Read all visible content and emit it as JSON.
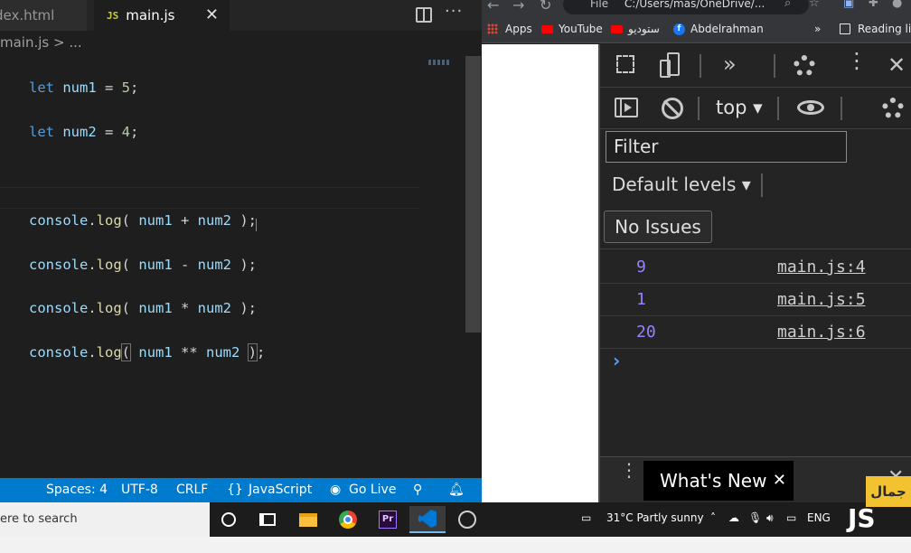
{
  "editor": {
    "tabs": [
      {
        "label": "dex.html"
      },
      {
        "label": "main.js",
        "badge": "JS"
      }
    ],
    "breadcrumb": "main.js > ...",
    "code_lines": [
      "let num1 = 5;",
      "let num2 = 4;",
      "",
      "console.log( num1 + num2 );",
      "console.log( num1 - num2 );",
      "console.log( num1 * num2 );",
      "console.log( num1 ** num2 );"
    ],
    "status": {
      "spaces": "Spaces: 4",
      "encoding": "UTF-8",
      "eol": "CRLF",
      "language": "JavaScript",
      "go_live": "Go Live"
    }
  },
  "browser": {
    "address": "C:/Users/mas/OneDrive/...",
    "file_label": "File",
    "bookmarks": [
      {
        "label": "Apps",
        "icon": "apps-grid-icon"
      },
      {
        "label": "YouTube",
        "icon": "youtube-icon"
      },
      {
        "label": "ستوديو",
        "icon": "youtube-icon"
      },
      {
        "label": "Abdelrahman",
        "icon": "facebook-icon"
      }
    ],
    "more_bookmarks": "»",
    "reading_list": "Reading list"
  },
  "devtools": {
    "context": "top ▾",
    "filter_placeholder": "Filter",
    "levels": "Default levels ▾",
    "issues": "No Issues",
    "logs": [
      {
        "value": "9",
        "source": "main.js:4"
      },
      {
        "value": "1",
        "source": "main.js:5"
      },
      {
        "value": "20",
        "source": "main.js:6"
      }
    ],
    "prompt": "›",
    "drawer_tab": "What's New"
  },
  "taskbar": {
    "search": "ere to search",
    "weather": "31°C  Partly sunny",
    "lang": "ENG",
    "accent": "#007acc"
  },
  "logo": {
    "top_text": "جمال",
    "bottom_text": "JS"
  }
}
